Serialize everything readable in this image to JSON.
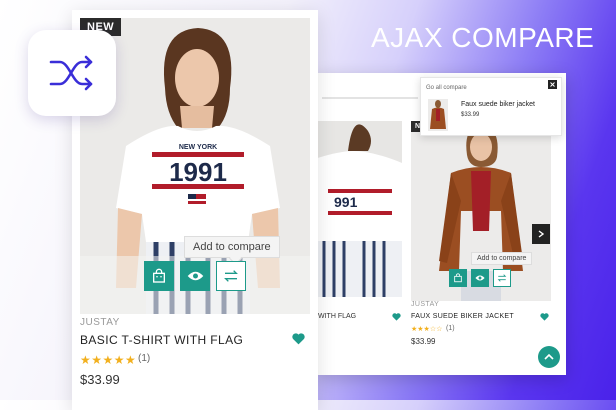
{
  "header": {
    "title": "AJAX COMPARE"
  },
  "main_product": {
    "badge": "NEW",
    "tooltip": "Add to compare",
    "vendor": "JUSTAY",
    "name": "BASIC T-SHIRT WITH FLAG",
    "stars": "★★★★★",
    "review_count": "(1)",
    "price": "$33.99",
    "shirt_print_top": "NEW YORK",
    "shirt_print_year": "1991"
  },
  "back_panel": {
    "left_product_name": "WITH FLAG",
    "badge": "N",
    "tooltip": "Add to compare",
    "vendor": "JUSTAY",
    "name": "FAUX SUEDE BIKER JACKET",
    "stars": "★★★☆☆",
    "review_count": "(1)",
    "price": "$33.99"
  },
  "compare_popup": {
    "link_label": "Go all compare",
    "product_name": "Faux suede biker jacket",
    "price": "$33.99"
  },
  "icons": [
    "shuffle-icon",
    "bag-icon",
    "eye-icon",
    "compare-arrows-icon",
    "heart-icon",
    "chevron-right-icon",
    "chevron-up-icon",
    "close-icon"
  ],
  "colors": {
    "accent": "#1d9a8a",
    "star": "#f2b01e",
    "background_purple": "#4a22ea"
  }
}
